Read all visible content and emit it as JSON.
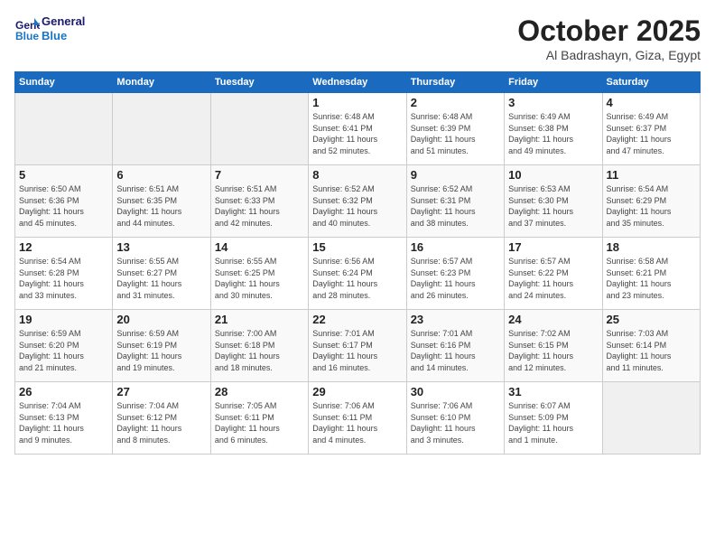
{
  "header": {
    "logo_line1": "General",
    "logo_line2": "Blue",
    "month": "October 2025",
    "location": "Al Badrashayn, Giza, Egypt"
  },
  "days_of_week": [
    "Sunday",
    "Monday",
    "Tuesday",
    "Wednesday",
    "Thursday",
    "Friday",
    "Saturday"
  ],
  "weeks": [
    [
      {
        "day": "",
        "info": ""
      },
      {
        "day": "",
        "info": ""
      },
      {
        "day": "",
        "info": ""
      },
      {
        "day": "1",
        "info": "Sunrise: 6:48 AM\nSunset: 6:41 PM\nDaylight: 11 hours\nand 52 minutes."
      },
      {
        "day": "2",
        "info": "Sunrise: 6:48 AM\nSunset: 6:39 PM\nDaylight: 11 hours\nand 51 minutes."
      },
      {
        "day": "3",
        "info": "Sunrise: 6:49 AM\nSunset: 6:38 PM\nDaylight: 11 hours\nand 49 minutes."
      },
      {
        "day": "4",
        "info": "Sunrise: 6:49 AM\nSunset: 6:37 PM\nDaylight: 11 hours\nand 47 minutes."
      }
    ],
    [
      {
        "day": "5",
        "info": "Sunrise: 6:50 AM\nSunset: 6:36 PM\nDaylight: 11 hours\nand 45 minutes."
      },
      {
        "day": "6",
        "info": "Sunrise: 6:51 AM\nSunset: 6:35 PM\nDaylight: 11 hours\nand 44 minutes."
      },
      {
        "day": "7",
        "info": "Sunrise: 6:51 AM\nSunset: 6:33 PM\nDaylight: 11 hours\nand 42 minutes."
      },
      {
        "day": "8",
        "info": "Sunrise: 6:52 AM\nSunset: 6:32 PM\nDaylight: 11 hours\nand 40 minutes."
      },
      {
        "day": "9",
        "info": "Sunrise: 6:52 AM\nSunset: 6:31 PM\nDaylight: 11 hours\nand 38 minutes."
      },
      {
        "day": "10",
        "info": "Sunrise: 6:53 AM\nSunset: 6:30 PM\nDaylight: 11 hours\nand 37 minutes."
      },
      {
        "day": "11",
        "info": "Sunrise: 6:54 AM\nSunset: 6:29 PM\nDaylight: 11 hours\nand 35 minutes."
      }
    ],
    [
      {
        "day": "12",
        "info": "Sunrise: 6:54 AM\nSunset: 6:28 PM\nDaylight: 11 hours\nand 33 minutes."
      },
      {
        "day": "13",
        "info": "Sunrise: 6:55 AM\nSunset: 6:27 PM\nDaylight: 11 hours\nand 31 minutes."
      },
      {
        "day": "14",
        "info": "Sunrise: 6:55 AM\nSunset: 6:25 PM\nDaylight: 11 hours\nand 30 minutes."
      },
      {
        "day": "15",
        "info": "Sunrise: 6:56 AM\nSunset: 6:24 PM\nDaylight: 11 hours\nand 28 minutes."
      },
      {
        "day": "16",
        "info": "Sunrise: 6:57 AM\nSunset: 6:23 PM\nDaylight: 11 hours\nand 26 minutes."
      },
      {
        "day": "17",
        "info": "Sunrise: 6:57 AM\nSunset: 6:22 PM\nDaylight: 11 hours\nand 24 minutes."
      },
      {
        "day": "18",
        "info": "Sunrise: 6:58 AM\nSunset: 6:21 PM\nDaylight: 11 hours\nand 23 minutes."
      }
    ],
    [
      {
        "day": "19",
        "info": "Sunrise: 6:59 AM\nSunset: 6:20 PM\nDaylight: 11 hours\nand 21 minutes."
      },
      {
        "day": "20",
        "info": "Sunrise: 6:59 AM\nSunset: 6:19 PM\nDaylight: 11 hours\nand 19 minutes."
      },
      {
        "day": "21",
        "info": "Sunrise: 7:00 AM\nSunset: 6:18 PM\nDaylight: 11 hours\nand 18 minutes."
      },
      {
        "day": "22",
        "info": "Sunrise: 7:01 AM\nSunset: 6:17 PM\nDaylight: 11 hours\nand 16 minutes."
      },
      {
        "day": "23",
        "info": "Sunrise: 7:01 AM\nSunset: 6:16 PM\nDaylight: 11 hours\nand 14 minutes."
      },
      {
        "day": "24",
        "info": "Sunrise: 7:02 AM\nSunset: 6:15 PM\nDaylight: 11 hours\nand 12 minutes."
      },
      {
        "day": "25",
        "info": "Sunrise: 7:03 AM\nSunset: 6:14 PM\nDaylight: 11 hours\nand 11 minutes."
      }
    ],
    [
      {
        "day": "26",
        "info": "Sunrise: 7:04 AM\nSunset: 6:13 PM\nDaylight: 11 hours\nand 9 minutes."
      },
      {
        "day": "27",
        "info": "Sunrise: 7:04 AM\nSunset: 6:12 PM\nDaylight: 11 hours\nand 8 minutes."
      },
      {
        "day": "28",
        "info": "Sunrise: 7:05 AM\nSunset: 6:11 PM\nDaylight: 11 hours\nand 6 minutes."
      },
      {
        "day": "29",
        "info": "Sunrise: 7:06 AM\nSunset: 6:11 PM\nDaylight: 11 hours\nand 4 minutes."
      },
      {
        "day": "30",
        "info": "Sunrise: 7:06 AM\nSunset: 6:10 PM\nDaylight: 11 hours\nand 3 minutes."
      },
      {
        "day": "31",
        "info": "Sunrise: 6:07 AM\nSunset: 5:09 PM\nDaylight: 11 hours\nand 1 minute."
      },
      {
        "day": "",
        "info": ""
      }
    ]
  ]
}
